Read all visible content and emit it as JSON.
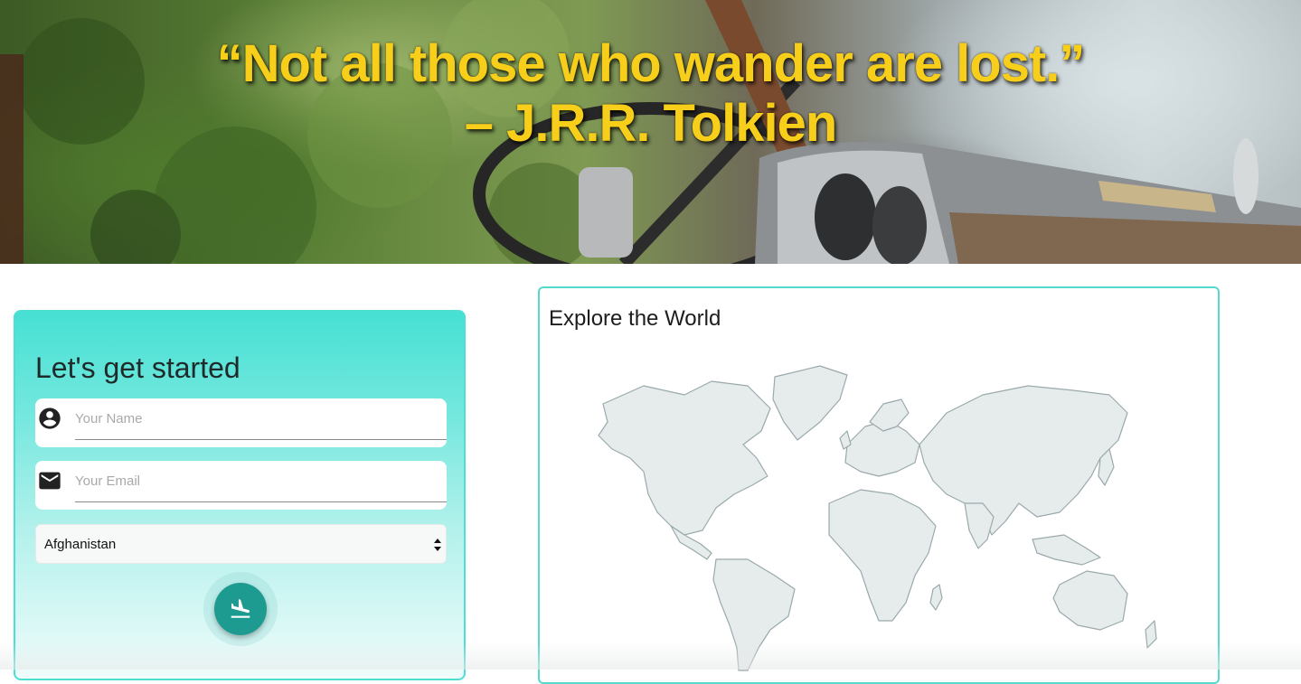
{
  "hero": {
    "quote_line1": "“Not all those who wander are lost.”",
    "quote_line2": "– J.R.R. Tolkien",
    "quote_color": "#f7cf1b"
  },
  "signup": {
    "title": "Let's get started",
    "name_placeholder": "Your Name",
    "name_icon": "account-circle-icon",
    "email_placeholder": "Your Email",
    "email_icon": "mail-icon",
    "country_selected": "Afghanistan",
    "submit_icon": "airplane-landing-icon",
    "card_gradient_top": "#46e0d3",
    "button_color": "#1d9b90"
  },
  "map": {
    "title": "Explore the World",
    "border_color": "#55d8cd",
    "land_color": "#e6ebec"
  }
}
